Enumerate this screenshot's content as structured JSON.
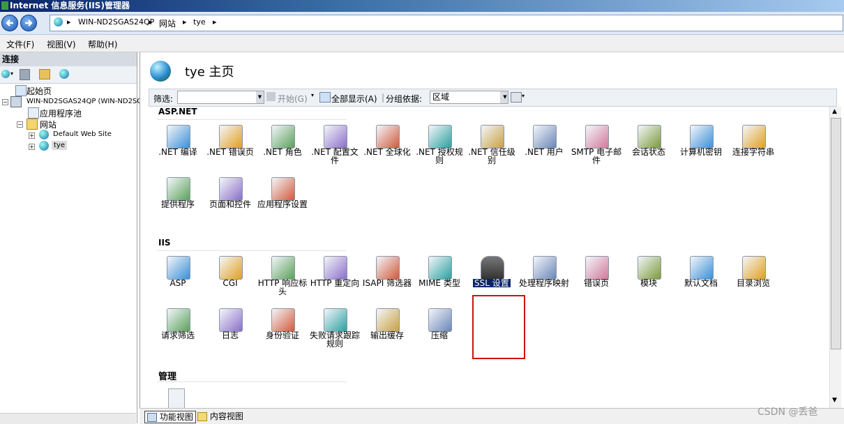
{
  "window": {
    "title": "Internet 信息服务(IIS)管理器"
  },
  "nav": {
    "back_icon": "back-arrow-icon",
    "forward_icon": "forward-arrow-icon",
    "breadcrumb": [
      "WIN-ND2SGAS24QP",
      "网站",
      "tye"
    ]
  },
  "menu": [
    "文件(F)",
    "视图(V)",
    "帮助(H)"
  ],
  "connections": {
    "header": "连接",
    "tree": [
      {
        "label": "起始页",
        "level": 1
      },
      {
        "label": "WIN-ND2SGAS24QP (WIN-ND2SG",
        "level": 0
      },
      {
        "label": "应用程序池",
        "level": 2
      },
      {
        "label": "网站",
        "level": 1
      },
      {
        "label": "Default Web Site",
        "level": 2
      },
      {
        "label": "tye",
        "level": 2,
        "selected": true
      }
    ]
  },
  "main": {
    "title": "tye 主页",
    "filter": {
      "label": "筛选:",
      "value": "",
      "start": "开始(G)",
      "show_all": "全部显示(A)",
      "group_label": "分组依据:",
      "group_value": "区域"
    },
    "sections": {
      "aspnet": {
        "title": "ASP.NET",
        "items": [
          ".NET 编译",
          ".NET 错误页",
          ".NET 角色",
          ".NET 配置文件",
          ".NET 全球化",
          ".NET 授权规则",
          ".NET 信任级别",
          ".NET 用户",
          "SMTP 电子邮件",
          "会话状态",
          "计算机密钥",
          "连接字符串",
          "提供程序",
          "页面和控件",
          "应用程序设置"
        ]
      },
      "iis": {
        "title": "IIS",
        "items": [
          "ASP",
          "CGI",
          "HTTP 响应标头",
          "HTTP 重定向",
          "ISAPI 筛选器",
          "MIME 类型",
          "SSL 设置",
          "处理程序映射",
          "错误页",
          "模块",
          "默认文档",
          "目录浏览",
          "请求筛选",
          "日志",
          "身份验证",
          "失败请求跟踪规则",
          "输出缓存",
          "压缩"
        ]
      },
      "manage": {
        "title": "管理"
      }
    },
    "selected_item": "SSL 设置"
  },
  "views": {
    "features": "功能视图",
    "content": "内容视图"
  },
  "watermark": "CSDN @丢爸",
  "colors": {
    "highlight_border": "#d01010",
    "selected_bg": "#0a246a"
  }
}
